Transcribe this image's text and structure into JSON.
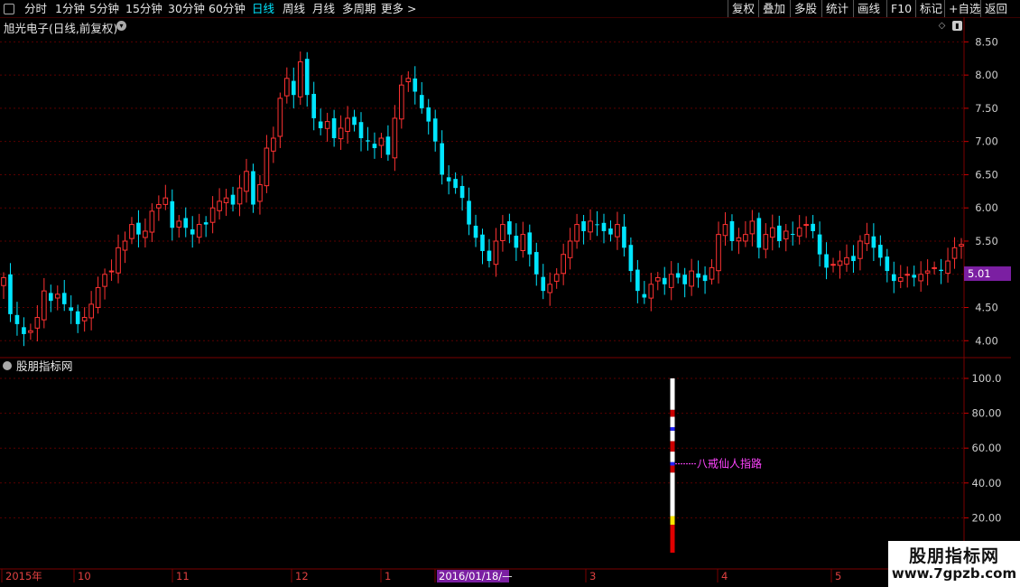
{
  "toolbar": {
    "periods": [
      "分时",
      "1分钟",
      "5分钟",
      "15分钟",
      "30分钟",
      "60分钟",
      "日线",
      "周线",
      "月线",
      "多周期",
      "更多 >"
    ],
    "active_period": "日线",
    "actions": [
      "复权",
      "叠加",
      "多股",
      "统计",
      "画线",
      "F10",
      "标记",
      "+自选",
      "返回"
    ]
  },
  "stock": {
    "title": "旭光电子(日线,前复权)",
    "last_price": "5.01"
  },
  "indicator": {
    "name": "股朋指标网",
    "annotation": "八戒仙人指路"
  },
  "watermark": {
    "line1": "股朋指标网",
    "line2": "www.7gpzb.com"
  },
  "colors": {
    "up": "#ff3232",
    "down": "#00e5ff",
    "accent": "#7b1fa2",
    "grid": "#5a0000",
    "annotation": "#ff44ff"
  },
  "chart_data": [
    {
      "type": "candlestick",
      "title": "旭光电子(日线,前复权)",
      "ylim": [
        3.8,
        8.6
      ],
      "yticks": [
        4.0,
        4.5,
        5.0,
        5.5,
        6.0,
        6.5,
        7.0,
        7.5,
        8.0,
        8.5
      ],
      "ytick_labels": [
        "4.00",
        "4.50",
        "5.00",
        "5.50",
        "6.00",
        "6.50",
        "7.00",
        "7.50",
        "8.00",
        "8.50"
      ],
      "close_series": [
        4.95,
        4.4,
        4.25,
        4.1,
        4.15,
        4.35,
        4.75,
        4.6,
        4.7,
        4.55,
        4.45,
        4.25,
        4.35,
        4.55,
        4.8,
        5.0,
        5.05,
        5.4,
        5.5,
        5.75,
        5.6,
        5.65,
        5.95,
        6.05,
        6.15,
        5.7,
        5.8,
        5.7,
        5.6,
        5.75,
        5.75,
        6.0,
        6.1,
        6.15,
        6.05,
        6.3,
        6.55,
        6.05,
        6.35,
        6.9,
        7.05,
        7.65,
        7.95,
        7.7,
        8.2,
        7.7,
        7.35,
        7.2,
        7.3,
        7.05,
        7.2,
        7.35,
        7.25,
        7.05,
        7.0,
        6.9,
        7.05,
        6.8,
        7.35,
        7.85,
        7.95,
        7.75,
        7.5,
        7.3,
        7.0,
        6.5,
        6.4,
        6.3,
        6.15,
        5.75,
        5.55,
        5.35,
        5.2,
        5.5,
        5.75,
        5.6,
        5.4,
        5.6,
        5.3,
        5.0,
        4.75,
        4.85,
        5.0,
        5.3,
        5.5,
        5.75,
        5.65,
        5.8,
        5.75,
        5.65,
        5.6,
        5.75,
        5.4,
        5.05,
        4.75,
        4.65,
        4.85,
        4.95,
        4.85,
        5.0,
        4.95,
        4.85,
        5.05,
        4.95,
        4.9,
        5.1,
        5.6,
        5.75,
        5.5,
        5.55,
        5.6,
        5.8,
        5.4,
        5.6,
        5.7,
        5.5,
        5.65,
        5.6,
        5.7,
        5.75,
        5.65,
        5.3,
        5.1,
        5.15,
        5.2,
        5.25,
        5.2,
        5.5,
        5.6,
        5.4,
        5.25,
        5.05,
        4.9,
        4.95,
        5.0,
        4.95,
        5.0,
        5.05,
        5.1,
        5.05,
        5.2,
        5.4,
        5.45
      ],
      "price_range_shown": [
        3.87,
        8.44
      ],
      "last_price": 5.01
    },
    {
      "type": "bar",
      "title": "股朋指标网",
      "ylim": [
        0,
        100
      ],
      "yticks": [
        20,
        40,
        60,
        80,
        100
      ],
      "ytick_labels": [
        "20.00",
        "40.00",
        "60.00",
        "80.00",
        "100.0"
      ],
      "signal_bar": {
        "top": 100,
        "bottom": 0,
        "annotation": "八戒仙人指路",
        "annotation_level": 51
      }
    }
  ],
  "date_axis": {
    "labels": [
      "2015年",
      "10",
      "11",
      "12",
      "1",
      "2016/01/18/—",
      "3",
      "4",
      "5"
    ],
    "highlight": "2016/01/18/—"
  }
}
